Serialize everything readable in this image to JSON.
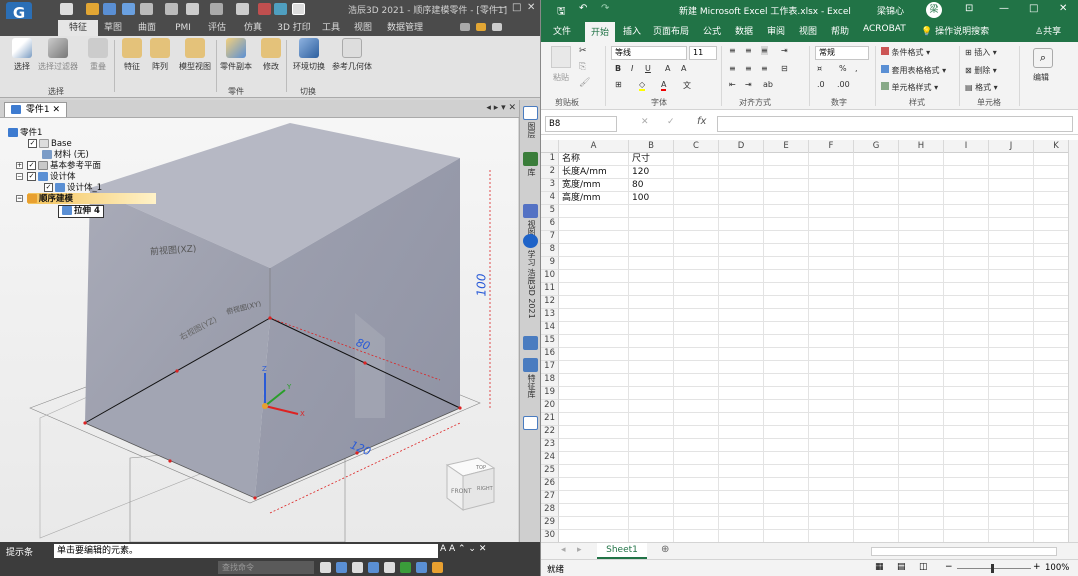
{
  "cad": {
    "logo": "G",
    "window_title": "浩辰3D 2021 - 顺序建模零件 - [零件1]",
    "window_controls": [
      "—",
      "□",
      "✕"
    ],
    "tabs": [
      "特征",
      "草图",
      "曲面",
      "PMI",
      "评估",
      "仿真",
      "3D 打印",
      "工具",
      "视图",
      "数据管理"
    ],
    "ribbon": {
      "buttons": [
        "选择",
        "选择过滤器",
        "重叠",
        "特征",
        "阵列",
        "模型视图",
        "零件副本",
        "修改",
        "环境切换",
        "参考几何体"
      ],
      "groups": [
        "选择",
        "零件",
        "切换"
      ]
    },
    "doc_tab": "零件1",
    "doc_tab_controls": "◂ ▸ ▾ ✕",
    "tree": {
      "root": "零件1",
      "base": "Base",
      "material": "材料 (无)",
      "ref_planes": "基本参考平面",
      "design_body": "设计体",
      "design_body_1": "设计体_1",
      "seq_modeling": "顺序建模",
      "extrude": "拉伸 4"
    },
    "model": {
      "dim_height": "100",
      "dim_depth": "80",
      "dim_width": "120",
      "plane_front": "前视图(XZ)",
      "plane_right": "右视图(YZ)",
      "plane_top": "俯视图(XY)",
      "viewcube_front": "FRONT",
      "viewcube_right": "RIGHT",
      "viewcube_top": "TOP",
      "axis_x": "X",
      "axis_y": "Y",
      "axis_z": "Z"
    },
    "sidebar": [
      "图层",
      "库",
      "视图",
      "学习 浩辰3D 2021",
      "特征库"
    ],
    "status": {
      "tip_label": "提示条",
      "tip_text": "单击要编辑的元素。",
      "tip_controls": "A A ⌃ ⌄ ✕",
      "cmd_placeholder": "查找命令"
    }
  },
  "excel": {
    "window_title": "新建 Microsoft Excel 工作表.xlsx - Excel",
    "user": "梁锦心",
    "user_initial": "梁",
    "window_controls": [
      "⊡",
      "—",
      "□",
      "✕"
    ],
    "tabs": [
      "文件",
      "开始",
      "插入",
      "页面布局",
      "公式",
      "数据",
      "审阅",
      "视图",
      "帮助",
      "ACROBAT",
      "操作说明搜索",
      "共享"
    ],
    "ribbon": {
      "clipboard": "剪贴板",
      "paste": "粘贴",
      "font_name": "等线",
      "font_size": "11",
      "font": "字体",
      "alignment": "对齐方式",
      "number_format": "常规",
      "number": "数字",
      "cond_format": "条件格式",
      "table_format": "套用表格格式",
      "cell_style": "单元格样式",
      "styles": "样式",
      "insert": "插入",
      "delete": "删除",
      "format": "格式",
      "cells": "单元格",
      "edit": "编辑"
    },
    "name_box": "B8",
    "fx": "fx",
    "columns": [
      "A",
      "B",
      "C",
      "D",
      "E",
      "F",
      "G",
      "H",
      "I",
      "J",
      "K"
    ],
    "rows": [
      "1",
      "2",
      "3",
      "4",
      "5",
      "6",
      "7",
      "8",
      "9",
      "10",
      "11",
      "12",
      "13",
      "14",
      "15",
      "16",
      "17",
      "18",
      "19",
      "20",
      "21",
      "22",
      "23",
      "24",
      "25",
      "26",
      "27",
      "28",
      "29",
      "30"
    ],
    "cells": [
      [
        "名称",
        "尺寸"
      ],
      [
        "长度A/mm",
        "120"
      ],
      [
        "宽度/mm",
        "80"
      ],
      [
        "高度/mm",
        "100"
      ]
    ],
    "sheet_tab": "Sheet1",
    "status_ready": "就绪",
    "zoom": "100%"
  }
}
